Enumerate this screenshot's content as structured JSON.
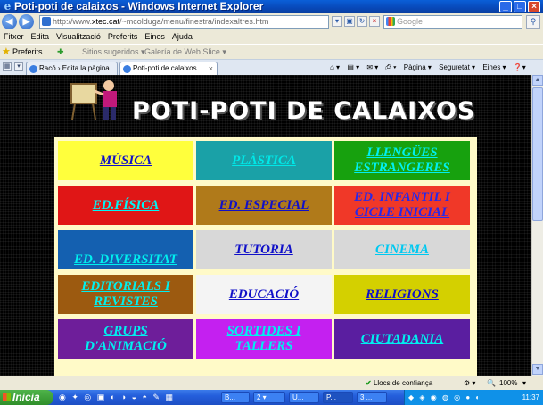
{
  "window": {
    "title": "Poti-poti de calaixos - Windows Internet Explorer",
    "min": "_",
    "max": "□",
    "close": "×"
  },
  "address": {
    "prefix": "http://www.",
    "domain": "xtec.cat",
    "path": "/~mcolduga/menu/finestra/indexaltres.htm",
    "search_placeholder": "Google"
  },
  "menu": [
    "Fitxer",
    "Edita",
    "Visualització",
    "Preferits",
    "Eines",
    "Ajuda"
  ],
  "favorites": {
    "label": "Preferits",
    "items": [
      "Sitios sugeridos ▾",
      "Galería de Web Slice ▾"
    ]
  },
  "tabs": [
    {
      "label": "Racó › Edita la pàgina ...",
      "active": false
    },
    {
      "label": "Poti-poti de calaixos",
      "active": true,
      "close": "×"
    }
  ],
  "command_bar": [
    "Pàgina ▾",
    "Seguretat ▾",
    "Eines ▾"
  ],
  "page": {
    "heading": "POTI-POTI DE CALAIXOS",
    "cells": [
      {
        "label": "MÚSICA",
        "bg": "#ffff3c",
        "fg": "#1010c8"
      },
      {
        "label": "PLÀSTICA",
        "bg": "#1aa1a7",
        "fg": "#00e8e8"
      },
      {
        "label": "LLENGÜES ESTRANGERES",
        "bg": "#17a10e",
        "fg": "#00f0f0"
      },
      {
        "label": "ED.FÍSICA",
        "bg": "#e01616",
        "fg": "#00f5f5"
      },
      {
        "label": "ED. ESPECIAL",
        "bg": "#b07a1a",
        "fg": "#1010c8"
      },
      {
        "label": "ED. INFANTIL I CICLE INICIAL",
        "bg": "#f03828",
        "fg": "#2828e8"
      },
      {
        "label": "ED. DIVERSITAT",
        "bg": "#1460b0",
        "fg": "#00f0f0"
      },
      {
        "label": "TUTORIA",
        "bg": "#d8d8d8",
        "fg": "#1010c8"
      },
      {
        "label": "CINEMA",
        "bg": "#d8d8d8",
        "fg": "#00c8f0"
      },
      {
        "label": "EDITORIALS I REVISTES",
        "bg": "#9c5a10",
        "fg": "#00f0f0"
      },
      {
        "label": "EDUCACIÓ",
        "bg": "#f4f4f4",
        "fg": "#1010c8"
      },
      {
        "label": "RELIGIONS",
        "bg": "#d4d000",
        "fg": "#1010c8"
      },
      {
        "label": "GRUPS D'ANIMACIÓ",
        "bg": "#6e1e9a",
        "fg": "#00f0f0"
      },
      {
        "label": "SORTIDES I TALLERS",
        "bg": "#c420f0",
        "fg": "#00f0f0"
      },
      {
        "label": "CIUTADANIA",
        "bg": "#5a1ea0",
        "fg": "#00f0f0"
      }
    ]
  },
  "status": {
    "zone": "Llocs de confiança",
    "zoom": "100%"
  },
  "taskbar": {
    "start": "Inicia",
    "items": [
      "B...",
      "2 ▾",
      "U...",
      "P...",
      "3 ..."
    ],
    "clock": "11:37"
  }
}
